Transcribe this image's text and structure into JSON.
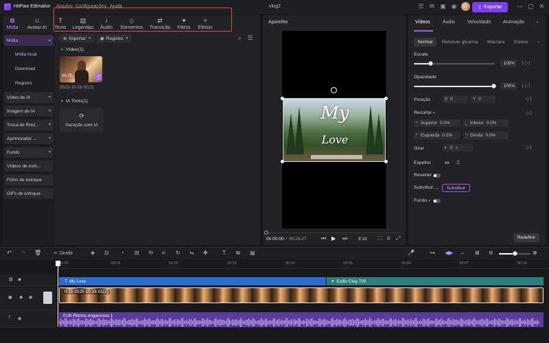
{
  "app": {
    "title": "HitPaw Edimakor",
    "project": "vlog2",
    "export_label": "Exportar"
  },
  "menu": [
    "Arquivo",
    "Configurações",
    "Ajuda"
  ],
  "top_tabs": [
    {
      "label": "Mídia",
      "icon": "media-icon"
    },
    {
      "label": "Avatar AI",
      "icon": "avatar-icon"
    },
    {
      "label": "Texto",
      "icon": "text-icon"
    },
    {
      "label": "Legendas",
      "icon": "subtitles-icon"
    },
    {
      "label": "Áudio",
      "icon": "music-icon"
    },
    {
      "label": "Elementos",
      "icon": "elements-icon"
    },
    {
      "label": "Transição",
      "icon": "transition-icon"
    },
    {
      "label": "Filtros",
      "icon": "filters-icon"
    },
    {
      "label": "Efeitos",
      "icon": "effects-icon"
    }
  ],
  "sidebar": {
    "items": [
      {
        "label": "Mídia"
      },
      {
        "label": "Mídia local"
      },
      {
        "label": "Download"
      },
      {
        "label": "Registro"
      },
      {
        "label": "Vídeo de IA"
      },
      {
        "label": "Imagem de IA"
      },
      {
        "label": "Troca de Rost..."
      },
      {
        "label": "Aprimorador ..."
      },
      {
        "label": "Fundo"
      },
      {
        "label": "Vídeos de esto..."
      },
      {
        "label": "Fotos de estoque"
      },
      {
        "label": "GIFs de estoque"
      }
    ]
  },
  "media": {
    "import_label": "Importar",
    "registry_label": "Registro",
    "video_section": "Vídeo(1)",
    "clip_duration": "00:15",
    "clip_date": "2025-10-28 02(2)",
    "ai_section": "IA Tools(1)",
    "ai_card_label": "Geração com IA"
  },
  "preview": {
    "label": "Aparelho",
    "title_line1": "My",
    "title_line2": "Love",
    "current_time": "00:00:00",
    "total_time": "00:23:27",
    "ratio": "9:16"
  },
  "right": {
    "tabs": [
      "Vídeos",
      "Áudio",
      "Velocidade",
      "Animação"
    ],
    "subtabs": [
      "Normal",
      "Remover glicemia",
      "Máscara",
      "Efeitos"
    ],
    "scale_label": "Escala",
    "scale_value": "100%",
    "scale_fraction": 0.2,
    "opacity_label": "Opacidade",
    "opacity_value": "100%",
    "opacity_fraction": 1.0,
    "position_label": "Posição",
    "pos_x_label": "X",
    "pos_x": "0",
    "pos_y_label": "Y",
    "pos_y": "0",
    "crop_label": "Recortar",
    "crop_top_label": "Superior",
    "crop_top": "0.0%",
    "crop_bottom_label": "Inferior",
    "crop_bottom": "0.0%",
    "crop_left_label": "Esquerda",
    "crop_left": "0.0%",
    "crop_right_label": "Direita",
    "crop_right": "0.0%",
    "rotate_label": "Girar",
    "rotate_value": "0",
    "mirror_label": "Espelho",
    "reverse_label": "Reverter",
    "replace_label": "Substituir ...",
    "replace_button": "Substituir",
    "background_label": "Fundo",
    "reset_label": "Redefinir"
  },
  "timeline": {
    "split_label": "Dividir",
    "ruler": [
      "00:00",
      "00:01",
      "00:02",
      "00:03",
      "00:04",
      "00:05",
      "00:06",
      "00:07",
      "00:08"
    ],
    "text_clip": "My Love",
    "style_clip": "Estilo Clog 709",
    "video_clip": "0:15  2025-10-28 02(2)",
    "audio_clip": "0:00  Ritmos enganosos 1"
  },
  "colors": {
    "accent": "#7b3ff2",
    "highlight_box": "#e5484d",
    "text_track": "#2a6bd0",
    "style_track": "#2f7d78",
    "audio_track": "#5b3b9a"
  }
}
